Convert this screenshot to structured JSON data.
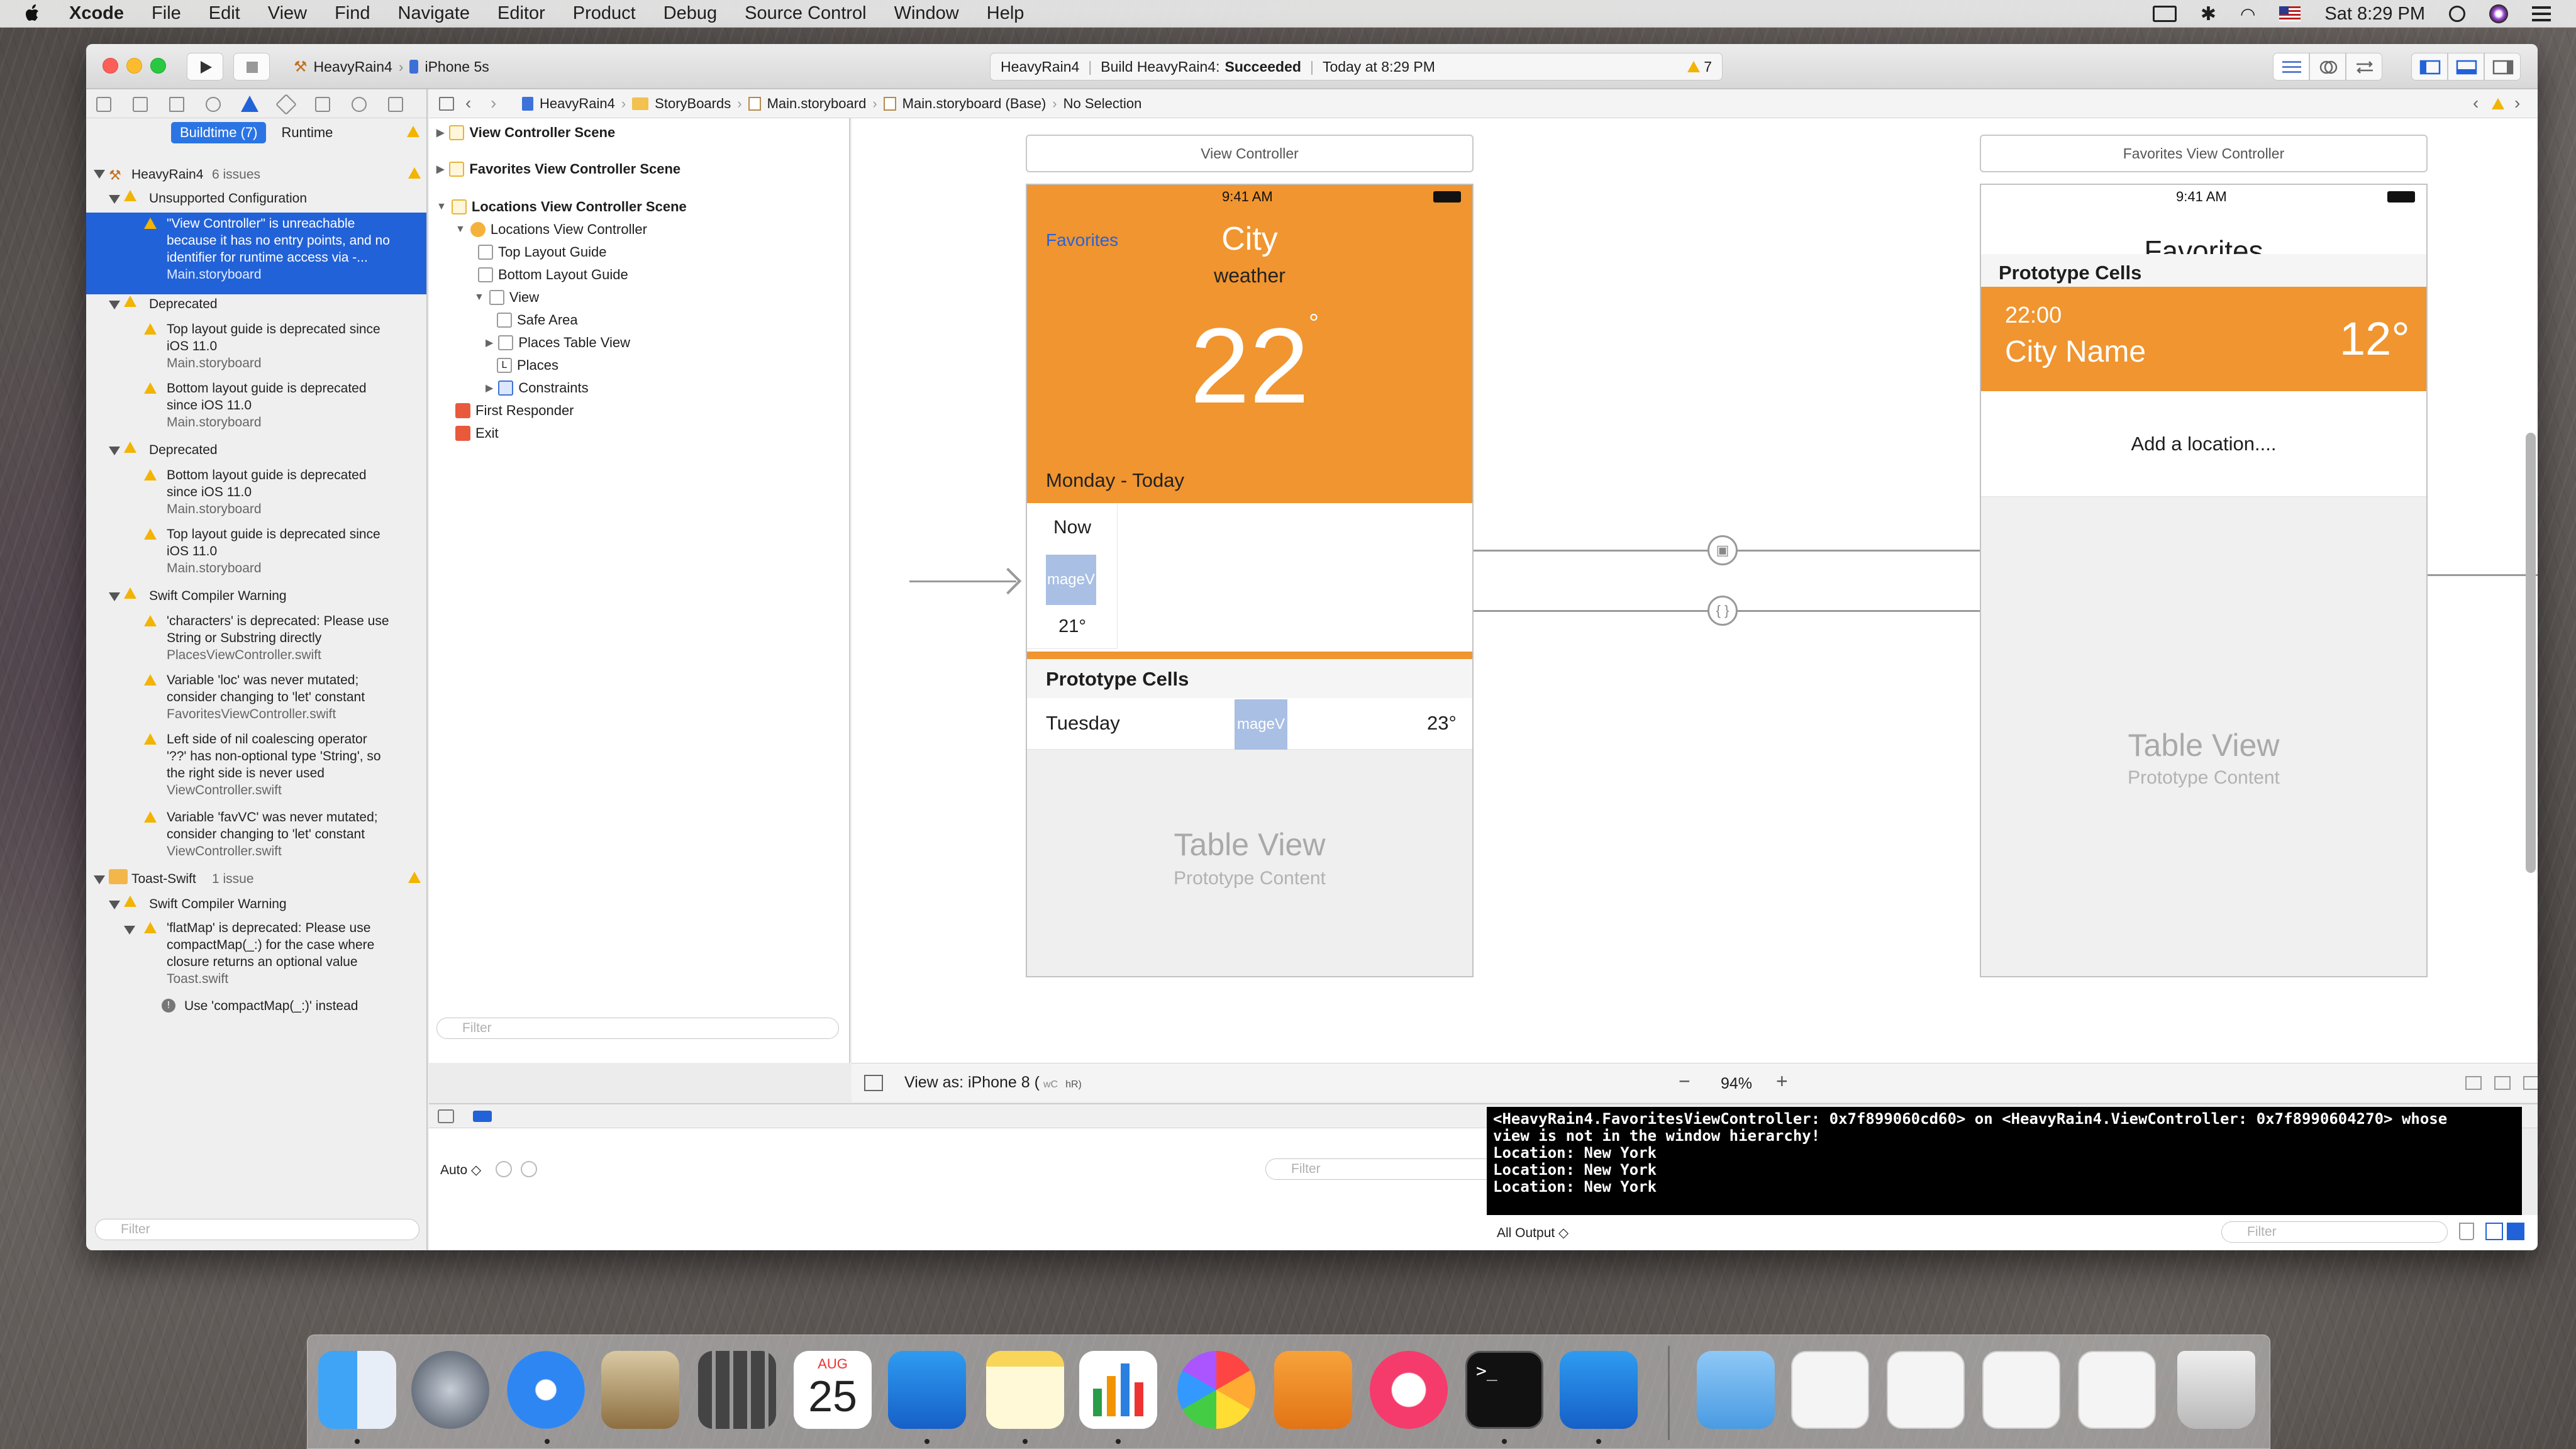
{
  "menubar": {
    "app": "Xcode",
    "items": [
      "File",
      "Edit",
      "View",
      "Find",
      "Navigate",
      "Editor",
      "Product",
      "Debug",
      "Source Control",
      "Window",
      "Help"
    ],
    "clock": "Sat 8:29 PM"
  },
  "toolbar": {
    "project": "HeavyRain4",
    "device": "iPhone 5s",
    "activity_project": "HeavyRain4",
    "build_label": "Build HeavyRain4:",
    "build_status": "Succeeded",
    "time": "Today at 8:29 PM",
    "warning_count": "7"
  },
  "navigator": {
    "seg_buildtime": "Buildtime (7)",
    "seg_runtime": "Runtime",
    "project": "HeavyRain4",
    "project_issues": "6 issues",
    "g1": "Unsupported Configuration",
    "sel1": "\"View Controller\" is unreachable",
    "sel2": "because it has no entry points, and no",
    "sel3": "identifier for runtime access via -...",
    "sel4": "Main.storyboard",
    "g2": "Deprecated",
    "i1a": "Top layout guide is deprecated since",
    "i1b": "iOS 11.0",
    "i1c": "Main.storyboard",
    "i2a": "Bottom layout guide is deprecated",
    "i2b": "since iOS 11.0",
    "i2c": "Main.storyboard",
    "g3": "Deprecated",
    "i3a": "Bottom layout guide is deprecated",
    "i3b": "since iOS 11.0",
    "i3c": "Main.storyboard",
    "i4a": "Top layout guide is deprecated since",
    "i4b": "iOS 11.0",
    "i4c": "Main.storyboard",
    "g4": "Swift Compiler Warning",
    "i5a": "'characters' is deprecated: Please use",
    "i5b": "String or Substring directly",
    "i5c": "PlacesViewController.swift",
    "i6a": "Variable 'loc' was never mutated;",
    "i6b": "consider changing to 'let' constant",
    "i6c": "FavoritesViewController.swift",
    "i7a": "Left side of nil coalescing operator",
    "i7b": "'??' has non-optional type 'String', so",
    "i7c": "the right side is never used",
    "i7d": "ViewController.swift",
    "i8a": "Variable 'favVC' was never mutated;",
    "i8b": "consider changing to 'let' constant",
    "i8c": "ViewController.swift",
    "project2": "Toast-Swift",
    "project2_issues": "1 issue",
    "g5": "Swift Compiler Warning",
    "i9a": "'flatMap' is deprecated: Please use",
    "i9b": "compactMap(_:) for the case where",
    "i9c": "closure returns an optional value",
    "i9d": "Toast.swift",
    "fix": "Use 'compactMap(_:)' instead",
    "filter": "Filter"
  },
  "jumpbar": {
    "p1": "HeavyRain4",
    "p2": "StoryBoards",
    "p3": "Main.storyboard",
    "p4": "Main.storyboard (Base)",
    "p5": "No Selection"
  },
  "outline": {
    "s1": "View Controller Scene",
    "s2": "Favorites View Controller Scene",
    "s3": "Locations View Controller Scene",
    "o1": "Locations View Controller",
    "o2": "Top Layout Guide",
    "o3": "Bottom Layout Guide",
    "o4": "View",
    "o5": "Safe Area",
    "o6": "Places Table View",
    "o7": "Places",
    "o8": "Constraints",
    "o9": "First Responder",
    "o10": "Exit",
    "filter": "Filter"
  },
  "scene1": {
    "header": "View Controller",
    "time": "9:41 AM",
    "favorites": "Favorites",
    "city": "City",
    "weather": "weather",
    "temp": "22",
    "deg": "°",
    "day": "Monday - Today",
    "now": "Now",
    "image": "mageV",
    "now_temp": "21°",
    "proto": "Prototype Cells",
    "tuesday": "Tuesday",
    "tue_temp": "23°",
    "table": "Table View",
    "table_sub": "Prototype Content"
  },
  "scene2": {
    "header": "Favorites View Controller",
    "time": "9:41 AM",
    "title": "Favorites",
    "proto": "Prototype Cells",
    "cell_time": "22:00",
    "cell_city": "City Name",
    "cell_temp": "12°",
    "add": "Add a location....",
    "table": "Table View",
    "table_sub": "Prototype Content"
  },
  "canvasbar": {
    "viewas": "View as: iPhone 8 (",
    "viewas_wc": "wC",
    "viewas_hr": "hR)",
    "zoom": "94%"
  },
  "debug": {
    "auto": "Auto ◇",
    "filter": "Filter",
    "all_output": "All Output ◇",
    "console": "<HeavyRain4.FavoritesViewController: 0x7f899060cd60> on <HeavyRain4.ViewController: 0x7f8990604270> whose\nview is not in the window hierarchy!\nLocation: New York\nLocation: New York\nLocation: New York"
  },
  "dock": {
    "calendar_month": "AUG",
    "calendar_day": "25"
  },
  "colors": {
    "accent": "#2262d8",
    "orange": "#f0952f",
    "warning": "#f2b400"
  }
}
